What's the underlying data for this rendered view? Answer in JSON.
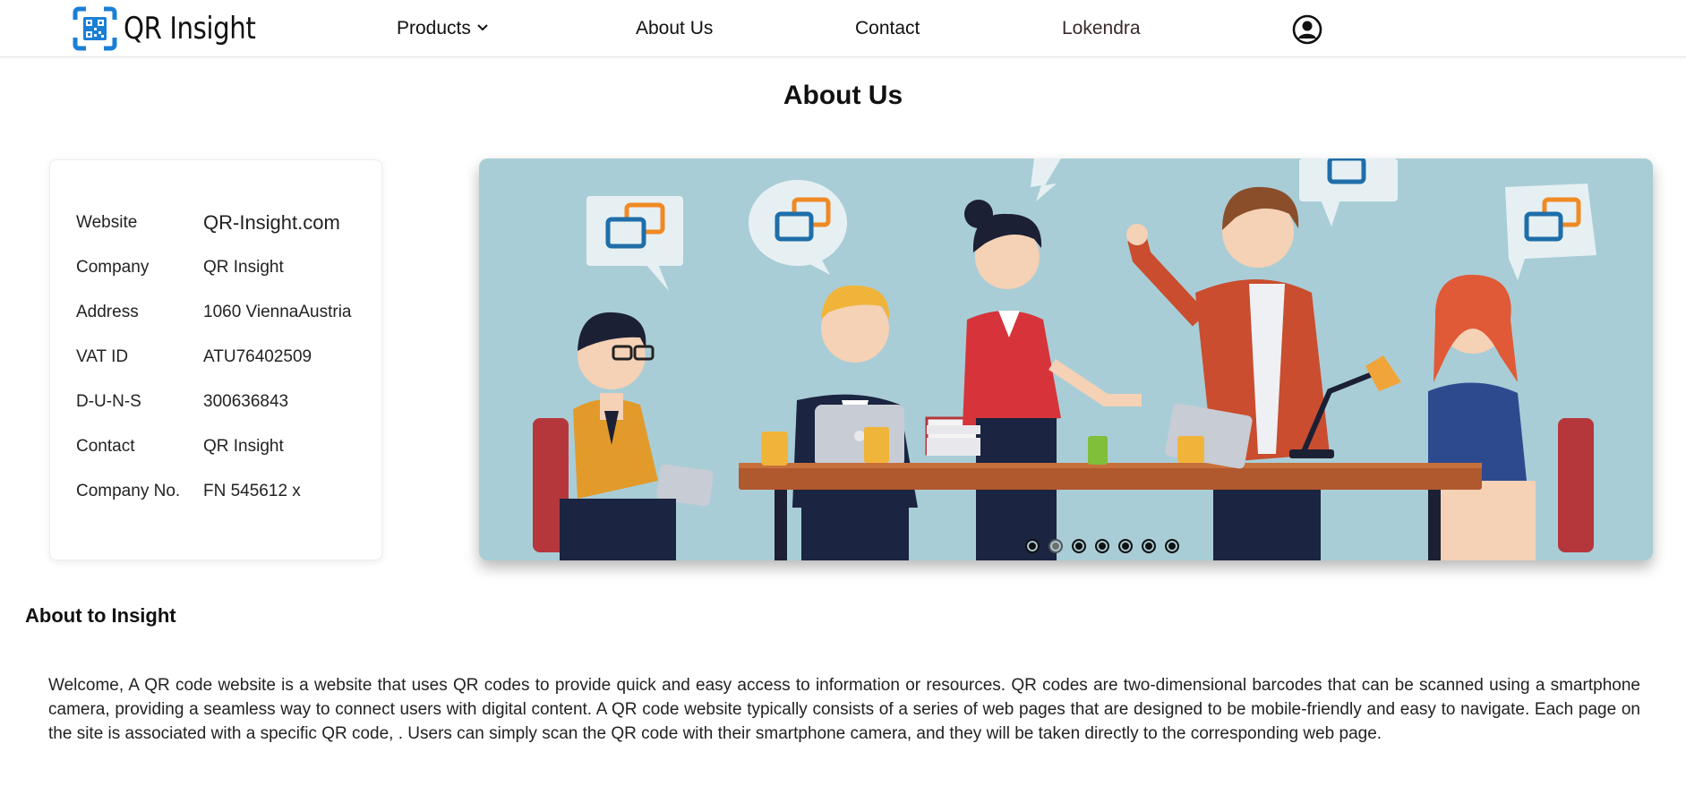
{
  "brand": {
    "name": "QR Insight",
    "accent": "#1a7fd6"
  },
  "nav": {
    "products": "Products",
    "about": "About Us",
    "contact": "Contact",
    "user": "Lokendra",
    "products_icon": "chevron-down-icon",
    "account_icon": "user-circle-icon"
  },
  "page": {
    "title": "About Us"
  },
  "info": {
    "rows": [
      {
        "label": "Website",
        "value": "QR-Insight.com"
      },
      {
        "label": "Company",
        "value": "QR Insight"
      },
      {
        "label": "Address",
        "value": "1060 ViennaAustria"
      },
      {
        "label": "VAT ID",
        "value": "ATU76402509"
      },
      {
        "label": "D-U-N-S",
        "value": "300636843"
      },
      {
        "label": "Contact",
        "value": "QR Insight"
      },
      {
        "label": "Company No.",
        "value": "FN 545612 x"
      }
    ]
  },
  "slider": {
    "slide_count": 7,
    "active_index": 1,
    "background": "#a9cdd6"
  },
  "about": {
    "heading": "About to Insight",
    "text": "Welcome, A QR code website is a website that uses QR codes to provide quick and easy access to information or resources. QR codes are two-dimensional barcodes that can be scanned using a smartphone camera, providing a seamless way to connect users with digital content. A QR code website typically consists of a series of web pages that are designed to be mobile-friendly and easy to navigate. Each page on the site is associated with a specific QR code, . Users can simply scan the QR code with their smartphone camera, and they will be taken directly to the corresponding web page."
  }
}
